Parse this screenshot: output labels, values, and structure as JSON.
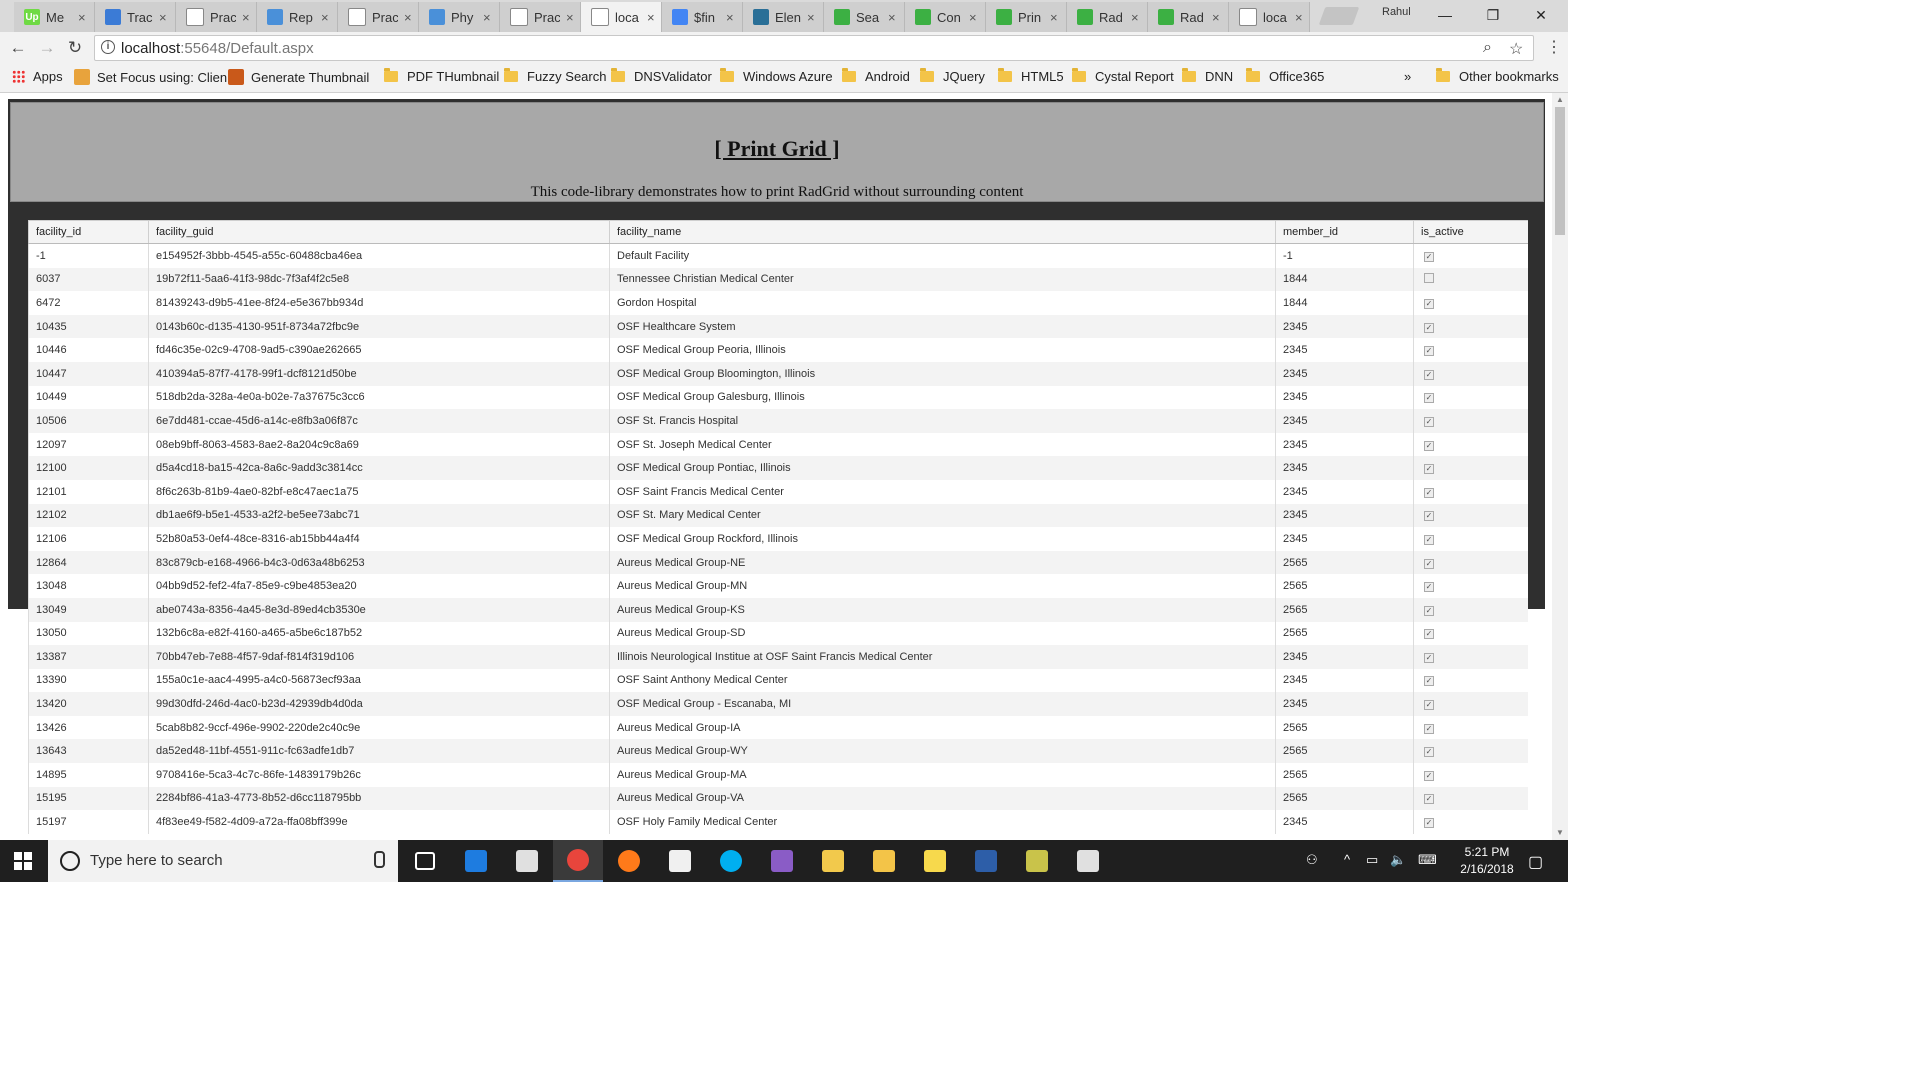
{
  "browser": {
    "tabs": [
      {
        "title": "Me",
        "fav_color": "#6fda44",
        "fav_text": "Up"
      },
      {
        "title": "Trac",
        "fav_color": "#3b7bd6",
        "fav_text": ""
      },
      {
        "title": "Prac",
        "fav_color": "#ffffff",
        "fav_text": ""
      },
      {
        "title": "Rep",
        "fav_color": "#4a90d9",
        "fav_text": ""
      },
      {
        "title": "Prac",
        "fav_color": "#ffffff",
        "fav_text": ""
      },
      {
        "title": "Phy",
        "fav_color": "#4a90d9",
        "fav_text": ""
      },
      {
        "title": "Prac",
        "fav_color": "#ffffff",
        "fav_text": ""
      },
      {
        "title": "loca",
        "fav_color": "#ffffff",
        "fav_text": ""
      },
      {
        "title": "$fin",
        "fav_color": "#4285f4",
        "fav_text": "G"
      },
      {
        "title": "Elen",
        "fav_color": "#2a6f97",
        "fav_text": ""
      },
      {
        "title": "Sea",
        "fav_color": "#3cb043",
        "fav_text": ""
      },
      {
        "title": "Con",
        "fav_color": "#3cb043",
        "fav_text": ""
      },
      {
        "title": "Prin",
        "fav_color": "#3cb043",
        "fav_text": ""
      },
      {
        "title": "Rad",
        "fav_color": "#3cb043",
        "fav_text": ""
      },
      {
        "title": "Rad",
        "fav_color": "#3cb043",
        "fav_text": ""
      },
      {
        "title": "loca",
        "fav_color": "#ffffff",
        "fav_text": ""
      }
    ],
    "tab_close": "×",
    "profile_name": "Rahul",
    "window": {
      "minimize": "—",
      "maximize": "❐",
      "close": "✕"
    },
    "url_host": "localhost",
    "url_path": ":55648/Default.aspx",
    "info_icon": "i",
    "zoom_icon": "⌕",
    "star_icon": "☆",
    "menu_icon": "⋮",
    "nav": {
      "back": "←",
      "forward": "→",
      "reload": "↻"
    },
    "bookmarks": [
      {
        "label": "Apps",
        "kind": "apps"
      },
      {
        "label": "Set Focus using: Clien",
        "kind": "icon",
        "color": "#e8a33c"
      },
      {
        "label": "Generate Thumbnail",
        "kind": "icon",
        "color": "#c9591a"
      },
      {
        "label": "PDF THumbnail",
        "kind": "folder"
      },
      {
        "label": "Fuzzy Search",
        "kind": "folder"
      },
      {
        "label": "DNSValidator",
        "kind": "folder"
      },
      {
        "label": "Windows Azure",
        "kind": "folder"
      },
      {
        "label": "Android",
        "kind": "folder"
      },
      {
        "label": "JQuery",
        "kind": "folder"
      },
      {
        "label": "HTML5",
        "kind": "folder"
      },
      {
        "label": "Cystal Report",
        "kind": "folder"
      },
      {
        "label": "DNN",
        "kind": "folder"
      },
      {
        "label": "Office365",
        "kind": "folder"
      }
    ],
    "bookmarks_overflow": "»",
    "other_bookmarks": "Other bookmarks"
  },
  "page": {
    "title": "[ Print Grid ]",
    "subtitle": "This code-library demonstrates how to print RadGrid without surrounding content",
    "grid": {
      "columns": [
        "facility_id",
        "facility_guid",
        "facility_name",
        "member_id",
        "is_active"
      ],
      "check_mark": "✓",
      "rows": [
        {
          "id": "-1",
          "guid": "e154952f-3bbb-4545-a55c-60488cba46ea",
          "name": "Default Facility",
          "member": "-1",
          "active": true
        },
        {
          "id": "6037",
          "guid": "19b72f11-5aa6-41f3-98dc-7f3af4f2c5e8",
          "name": "Tennessee Christian Medical Center",
          "member": "1844",
          "active": false
        },
        {
          "id": "6472",
          "guid": "81439243-d9b5-41ee-8f24-e5e367bb934d",
          "name": "Gordon Hospital",
          "member": "1844",
          "active": true
        },
        {
          "id": "10435",
          "guid": "0143b60c-d135-4130-951f-8734a72fbc9e",
          "name": "OSF Healthcare System",
          "member": "2345",
          "active": true
        },
        {
          "id": "10446",
          "guid": "fd46c35e-02c9-4708-9ad5-c390ae262665",
          "name": "OSF Medical Group Peoria, Illinois",
          "member": "2345",
          "active": true
        },
        {
          "id": "10447",
          "guid": "410394a5-87f7-4178-99f1-dcf8121d50be",
          "name": "OSF Medical Group Bloomington, Illinois",
          "member": "2345",
          "active": true
        },
        {
          "id": "10449",
          "guid": "518db2da-328a-4e0a-b02e-7a37675c3cc6",
          "name": "OSF Medical Group Galesburg, Illinois",
          "member": "2345",
          "active": true
        },
        {
          "id": "10506",
          "guid": "6e7dd481-ccae-45d6-a14c-e8fb3a06f87c",
          "name": "OSF St. Francis Hospital",
          "member": "2345",
          "active": true
        },
        {
          "id": "12097",
          "guid": "08eb9bff-8063-4583-8ae2-8a204c9c8a69",
          "name": "OSF St. Joseph Medical Center",
          "member": "2345",
          "active": true
        },
        {
          "id": "12100",
          "guid": "d5a4cd18-ba15-42ca-8a6c-9add3c3814cc",
          "name": "OSF Medical Group Pontiac, Illinois",
          "member": "2345",
          "active": true
        },
        {
          "id": "12101",
          "guid": "8f6c263b-81b9-4ae0-82bf-e8c47aec1a75",
          "name": "OSF Saint Francis Medical Center",
          "member": "2345",
          "active": true
        },
        {
          "id": "12102",
          "guid": "db1ae6f9-b5e1-4533-a2f2-be5ee73abc71",
          "name": "OSF St. Mary Medical Center",
          "member": "2345",
          "active": true
        },
        {
          "id": "12106",
          "guid": "52b80a53-0ef4-48ce-8316-ab15bb44a4f4",
          "name": "OSF Medical Group Rockford, Illinois",
          "member": "2345",
          "active": true
        },
        {
          "id": "12864",
          "guid": "83c879cb-e168-4966-b4c3-0d63a48b6253",
          "name": "Aureus Medical Group-NE",
          "member": "2565",
          "active": true
        },
        {
          "id": "13048",
          "guid": "04bb9d52-fef2-4fa7-85e9-c9be4853ea20",
          "name": "Aureus Medical Group-MN",
          "member": "2565",
          "active": true
        },
        {
          "id": "13049",
          "guid": "abe0743a-8356-4a45-8e3d-89ed4cb3530e",
          "name": "Aureus Medical Group-KS",
          "member": "2565",
          "active": true
        },
        {
          "id": "13050",
          "guid": "132b6c8a-e82f-4160-a465-a5be6c187b52",
          "name": "Aureus Medical Group-SD",
          "member": "2565",
          "active": true
        },
        {
          "id": "13387",
          "guid": "70bb47eb-7e88-4f57-9daf-f814f319d106",
          "name": "Illinois Neurological Institue at OSF Saint Francis Medical Center",
          "member": "2345",
          "active": true
        },
        {
          "id": "13390",
          "guid": "155a0c1e-aac4-4995-a4c0-56873ecf93aa",
          "name": "OSF Saint Anthony Medical Center",
          "member": "2345",
          "active": true
        },
        {
          "id": "13420",
          "guid": "99d30dfd-246d-4ac0-b23d-42939db4d0da",
          "name": "OSF Medical Group - Escanaba, MI",
          "member": "2345",
          "active": true
        },
        {
          "id": "13426",
          "guid": "5cab8b82-9ccf-496e-9902-220de2c40c9e",
          "name": "Aureus Medical Group-IA",
          "member": "2565",
          "active": true
        },
        {
          "id": "13643",
          "guid": "da52ed48-11bf-4551-911c-fc63adfe1db7",
          "name": "Aureus Medical Group-WY",
          "member": "2565",
          "active": true
        },
        {
          "id": "14895",
          "guid": "9708416e-5ca3-4c7c-86fe-14839179b26c",
          "name": "Aureus Medical Group-MA",
          "member": "2565",
          "active": true
        },
        {
          "id": "15195",
          "guid": "2284bf86-41a3-4773-8b52-d6cc118795bb",
          "name": "Aureus Medical Group-VA",
          "member": "2565",
          "active": true
        },
        {
          "id": "15197",
          "guid": "4f83ee49-f582-4d09-a72a-ffa08bff399e",
          "name": "OSF Holy Family Medical Center",
          "member": "2345",
          "active": true
        }
      ]
    }
  },
  "taskbar": {
    "search_placeholder": "Type here to search",
    "apps": [
      {
        "name": "task-view",
        "color": "#ffffff"
      },
      {
        "name": "edge",
        "color": "#1e7ce0"
      },
      {
        "name": "store",
        "color": "#e0e0e0"
      },
      {
        "name": "chrome",
        "color": "#e8453c"
      },
      {
        "name": "firefox",
        "color": "#ff7a1a"
      },
      {
        "name": "mail",
        "color": "#f0f0f0"
      },
      {
        "name": "skype",
        "color": "#00aff0"
      },
      {
        "name": "visual-studio",
        "color": "#8a5cc6"
      },
      {
        "name": "outlook-folder",
        "color": "#f2c94c"
      },
      {
        "name": "file-explorer",
        "color": "#f3c448"
      },
      {
        "name": "sticky-notes",
        "color": "#f7d94c"
      },
      {
        "name": "powershell",
        "color": "#2d5ea8"
      },
      {
        "name": "tools",
        "color": "#c9c34a"
      },
      {
        "name": "paint",
        "color": "#e0e0e0"
      }
    ],
    "tray_people": "⚇",
    "tray_up": "^",
    "tray_battery": "▭",
    "tray_volume": "🔈",
    "tray_keyboard": "⌨",
    "time": "5:21 PM",
    "date": "2/16/2018",
    "notifications": "▢"
  }
}
